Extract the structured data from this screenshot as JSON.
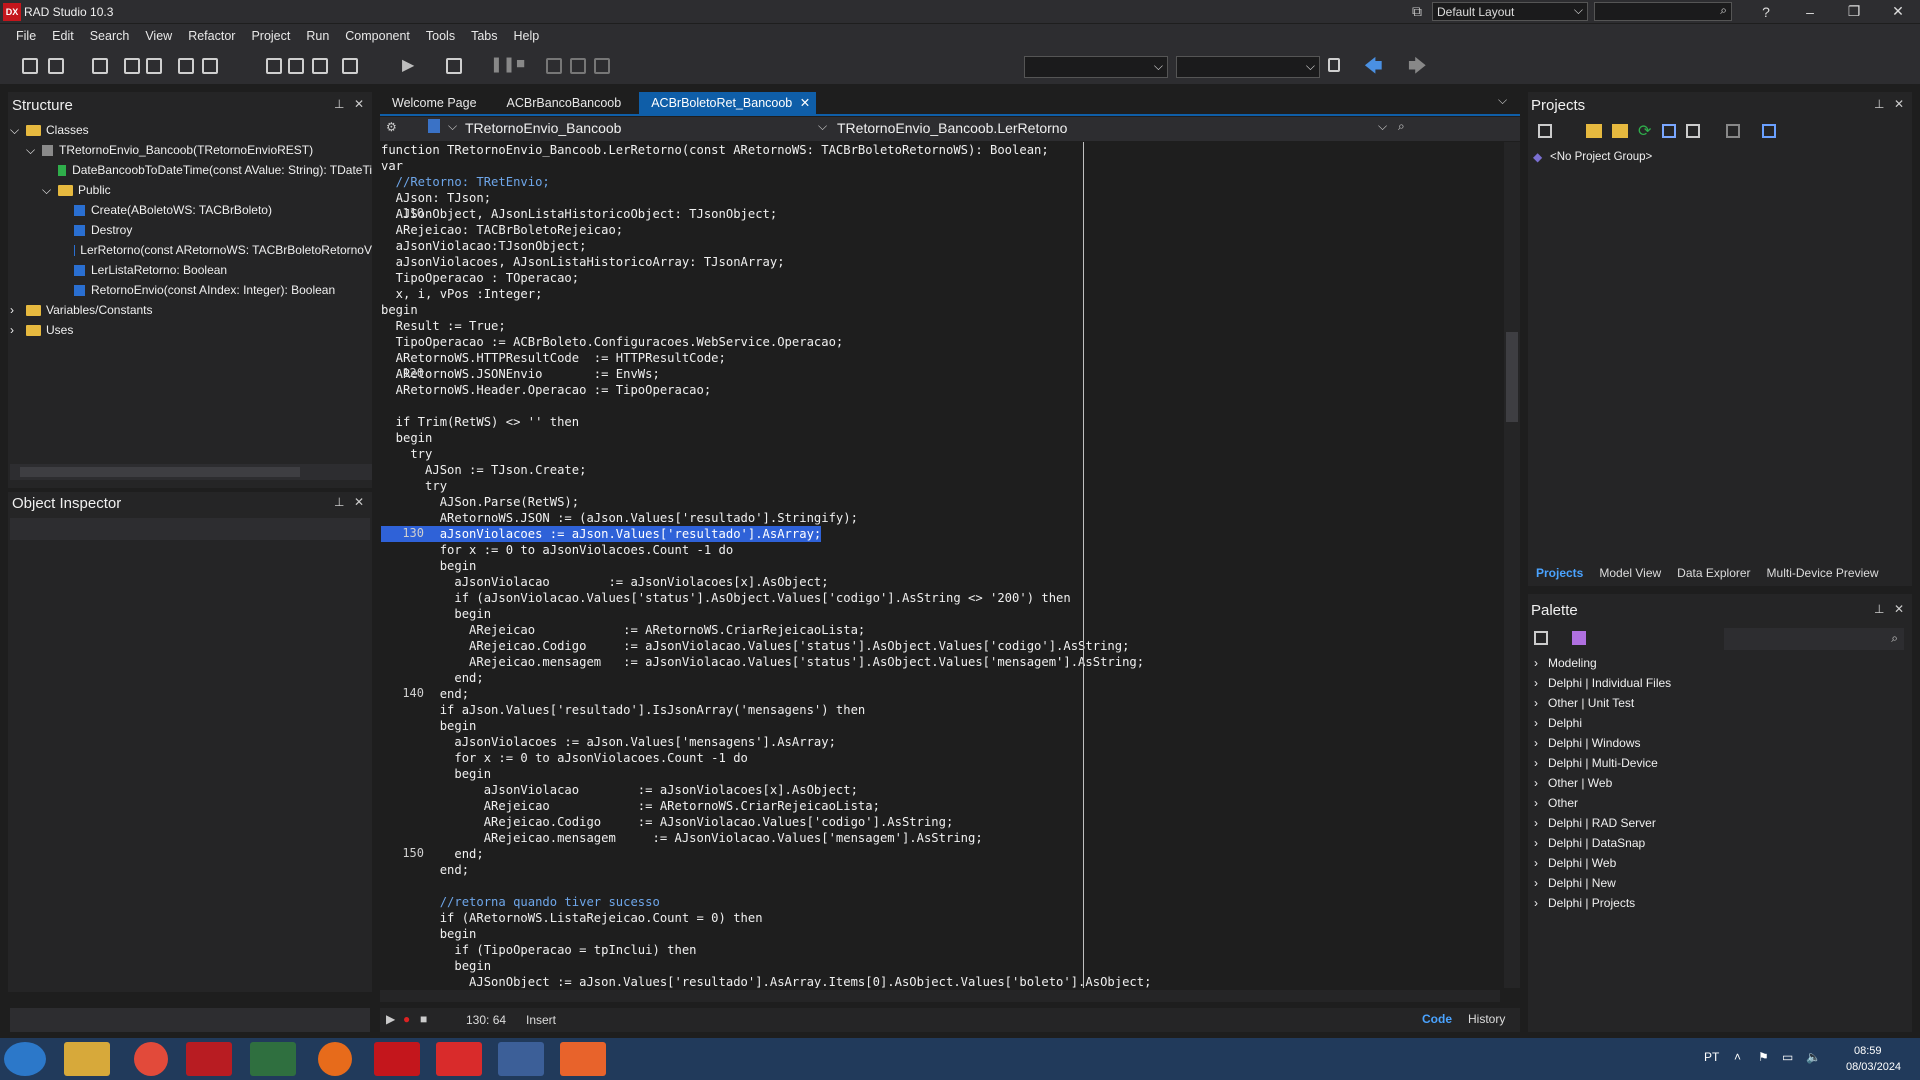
{
  "app": {
    "title": "RAD Studio 10.3",
    "logo": "DX",
    "layout": "Default Layout"
  },
  "menu": [
    "File",
    "Edit",
    "Search",
    "View",
    "Refactor",
    "Project",
    "Run",
    "Component",
    "Tools",
    "Tabs",
    "Help"
  ],
  "tabs": [
    "Welcome Page",
    "ACBrBancoBancoob",
    "ACBrBoletoRet_Bancoob"
  ],
  "editor": {
    "class_combo": "TRetornoEnvio_Bancoob",
    "method_combo": "TRetornoEnvio_Bancoob.LerRetorno"
  },
  "structure": {
    "title": "Structure",
    "items": [
      "Classes",
      "TRetornoEnvio_Bancoob(TRetornoEnvioREST)",
      "DateBancoobToDateTime(const AValue: String): TDateTi",
      "Public",
      "Create(ABoletoWS: TACBrBoleto)",
      "Destroy",
      "LerRetorno(const ARetornoWS: TACBrBoletoRetornoV",
      "LerListaRetorno: Boolean",
      "RetornoEnvio(const AIndex: Integer): Boolean",
      "Variables/Constants",
      "Uses"
    ]
  },
  "object_inspector": {
    "title": "Object Inspector"
  },
  "projects": {
    "title": "Projects",
    "root": "<No Project Group>",
    "tabs": [
      "Projects",
      "Model View",
      "Data Explorer",
      "Multi-Device Preview"
    ]
  },
  "palette": {
    "title": "Palette",
    "items": [
      "Modeling",
      "Delphi | Individual Files",
      "Other | Unit Test",
      "Delphi",
      "Delphi | Windows",
      "Delphi | Multi-Device",
      "Other | Web",
      "Other",
      "Delphi | RAD Server",
      "Delphi | DataSnap",
      "Delphi | Web",
      "Delphi | New",
      "Delphi | Projects"
    ]
  },
  "status": {
    "pos": "130: 64",
    "mode": "Insert",
    "code_tab": "Code",
    "history_tab": "History"
  },
  "tray": {
    "lang": "PT",
    "time": "08:59",
    "date": "08/03/2024"
  },
  "code": [
    {
      "n": "",
      "t": "function TRetornoEnvio_Bancoob.LerRetorno(const ARetornoWS: TACBrBoletoRetornoWS): Boolean;"
    },
    {
      "n": "",
      "t": "var"
    },
    {
      "n": "",
      "t": "  //Retorno: TRetEnvio;"
    },
    {
      "n": "",
      "t": "  AJson: TJson;"
    },
    {
      "n": "110",
      "t": "  AJSonObject, AJsonListaHistoricoObject: TJsonObject;"
    },
    {
      "n": "",
      "t": "  ARejeicao: TACBrBoletoRejeicao;"
    },
    {
      "n": "",
      "t": "  aJsonViolacao:TJsonObject;"
    },
    {
      "n": "",
      "t": "  aJsonViolacoes, AJsonListaHistoricoArray: TJsonArray;"
    },
    {
      "n": "",
      "t": "  TipoOperacao : TOperacao;"
    },
    {
      "n": "",
      "t": "  x, i, vPos :Integer;"
    },
    {
      "n": "",
      "t": "begin"
    },
    {
      "n": "",
      "t": "  Result := True;"
    },
    {
      "n": "",
      "t": "  TipoOperacao := ACBrBoleto.Configuracoes.WebService.Operacao;"
    },
    {
      "n": "",
      "t": "  ARetornoWS.HTTPResultCode  := HTTPResultCode;"
    },
    {
      "n": "120",
      "t": "  ARetornoWS.JSONEnvio       := EnvWs;"
    },
    {
      "n": "",
      "t": "  ARetornoWS.Header.Operacao := TipoOperacao;"
    },
    {
      "n": "",
      "t": ""
    },
    {
      "n": "",
      "t": "  if Trim(RetWS) <> '' then"
    },
    {
      "n": "",
      "t": "  begin"
    },
    {
      "n": "",
      "t": "    try"
    },
    {
      "n": "",
      "t": "      AJSon := TJson.Create;"
    },
    {
      "n": "",
      "t": "      try"
    },
    {
      "n": "",
      "t": "        AJSon.Parse(RetWS);"
    },
    {
      "n": "",
      "t": "        ARetornoWS.JSON := (aJson.Values['resultado'].Stringify);"
    },
    {
      "n": "130",
      "t": "        aJsonViolacoes := aJson.Values['resultado'].AsArray;",
      "sel": true
    },
    {
      "n": "",
      "t": "        for x := 0 to aJsonViolacoes.Count -1 do"
    },
    {
      "n": "",
      "t": "        begin"
    },
    {
      "n": "",
      "t": "          aJsonViolacao        := aJsonViolacoes[x].AsObject;"
    },
    {
      "n": "",
      "t": "          if (aJsonViolacao.Values['status'].AsObject.Values['codigo'].AsString <> '200') then"
    },
    {
      "n": "",
      "t": "          begin"
    },
    {
      "n": "",
      "t": "            ARejeicao            := ARetornoWS.CriarRejeicaoLista;"
    },
    {
      "n": "",
      "t": "            ARejeicao.Codigo     := aJsonViolacao.Values['status'].AsObject.Values['codigo'].AsString;"
    },
    {
      "n": "",
      "t": "            ARejeicao.mensagem   := aJsonViolacao.Values['status'].AsObject.Values['mensagem'].AsString;"
    },
    {
      "n": "",
      "t": "          end;"
    },
    {
      "n": "140",
      "t": "        end;"
    },
    {
      "n": "",
      "t": "        if aJson.Values['resultado'].IsJsonArray('mensagens') then"
    },
    {
      "n": "",
      "t": "        begin"
    },
    {
      "n": "",
      "t": "          aJsonViolacoes := aJson.Values['mensagens'].AsArray;"
    },
    {
      "n": "",
      "t": "          for x := 0 to aJsonViolacoes.Count -1 do"
    },
    {
      "n": "",
      "t": "          begin"
    },
    {
      "n": "",
      "t": "              aJsonViolacao        := aJsonViolacoes[x].AsObject;"
    },
    {
      "n": "",
      "t": "              ARejeicao            := ARetornoWS.CriarRejeicaoLista;"
    },
    {
      "n": "",
      "t": "              ARejeicao.Codigo     := AJsonViolacao.Values['codigo'].AsString;"
    },
    {
      "n": "",
      "t": "              ARejeicao.mensagem     := AJsonViolacao.Values['mensagem'].AsString;"
    },
    {
      "n": "150",
      "t": "          end;"
    },
    {
      "n": "",
      "t": "        end;"
    },
    {
      "n": "",
      "t": ""
    },
    {
      "n": "",
      "t": "        //retorna quando tiver sucesso"
    },
    {
      "n": "",
      "t": "        if (ARetornoWS.ListaRejeicao.Count = 0) then"
    },
    {
      "n": "",
      "t": "        begin"
    },
    {
      "n": "",
      "t": "          if (TipoOperacao = tpInclui) then"
    },
    {
      "n": "",
      "t": "          begin"
    },
    {
      "n": "",
      "t": "            AJSonObject := aJson.Values['resultado'].AsArray.Items[0].AsObject.Values['boleto'].AsObject;"
    }
  ]
}
